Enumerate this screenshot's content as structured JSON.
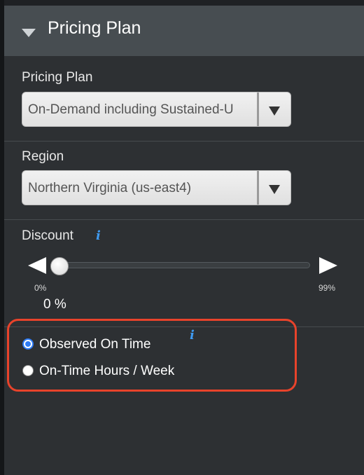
{
  "panel": {
    "title": "Pricing Plan",
    "collapse_icon": "triangle-down-icon"
  },
  "pricing_plan": {
    "label": "Pricing Plan",
    "selected_value": "On-Demand including Sustained-U",
    "dropdown_icon": "triangle-down-icon"
  },
  "region": {
    "label": "Region",
    "selected_value": "Northern Virginia (us-east4)",
    "dropdown_icon": "triangle-down-icon"
  },
  "discount": {
    "label": "Discount",
    "info_glyph": "i",
    "slider_value_fraction": 0.0,
    "min_label": "0%",
    "max_label": "99%",
    "value_text": "0 %"
  },
  "on_time": {
    "info_glyph": "i",
    "options": [
      {
        "label": "Observed On Time",
        "checked": true
      },
      {
        "label": "On-Time Hours / Week",
        "checked": false
      }
    ]
  },
  "colors": {
    "header_bg": "#474d51",
    "panel_bg": "#2d3033",
    "info_icon": "#3f9bf2",
    "radio_accent": "#2e7cf6",
    "highlight_border": "#e8432b"
  }
}
